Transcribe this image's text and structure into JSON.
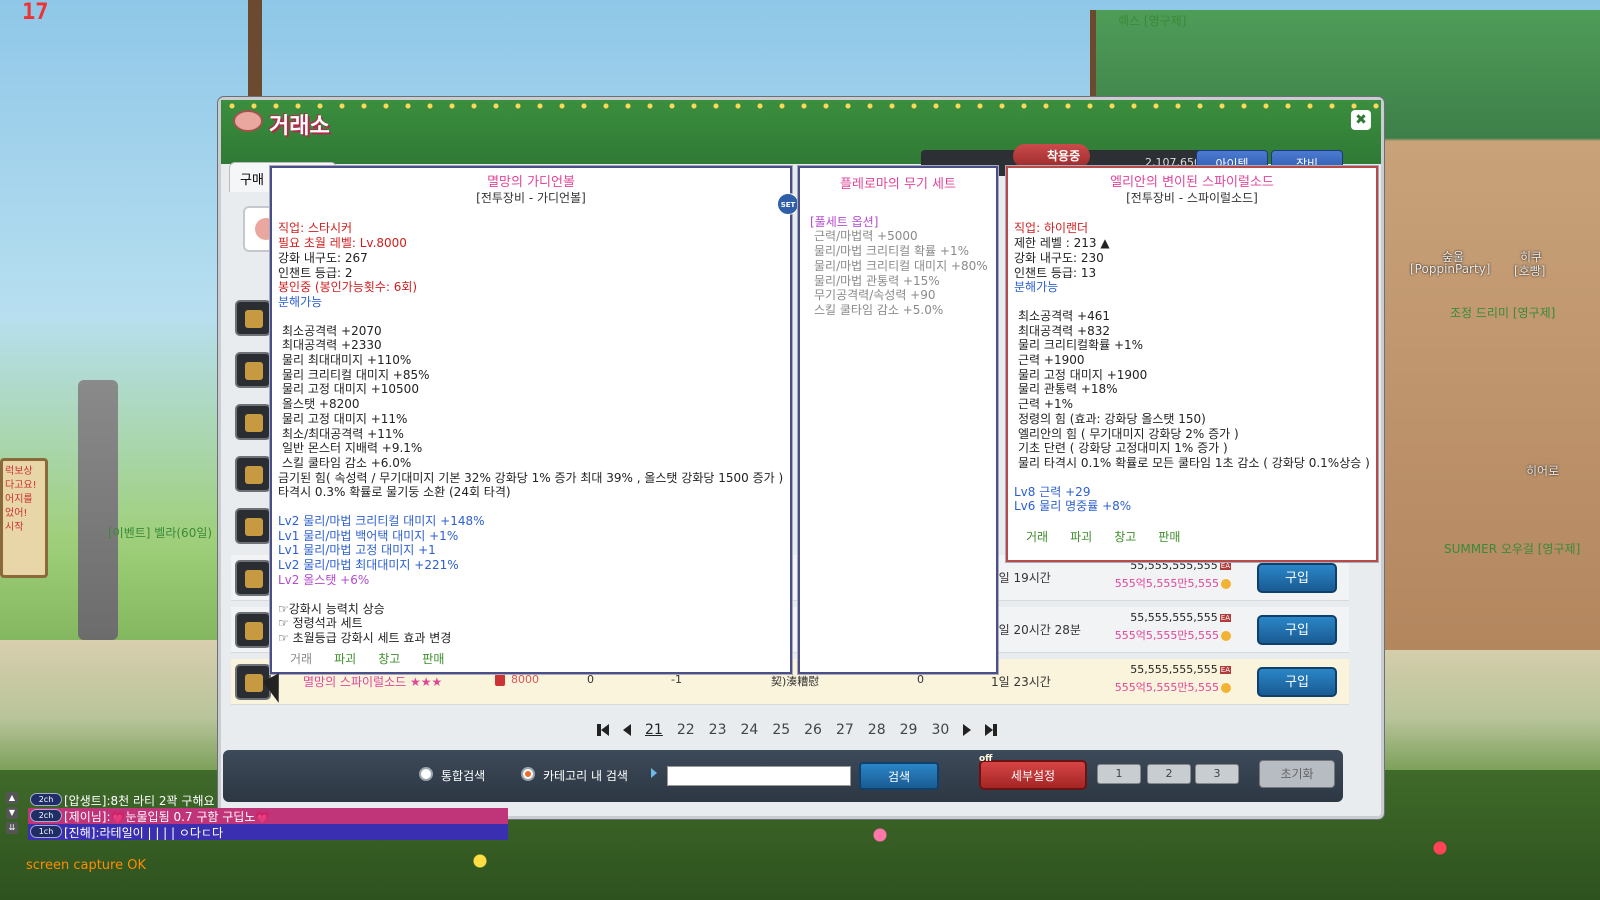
{
  "hud": {
    "top_left_number": "17"
  },
  "background": {
    "npc_names": [
      {
        "text": "렉스 [영구제]"
      },
      {
        "text": "[이벤트] 벨라(60일)"
      },
      {
        "text": "숲울"
      },
      {
        "text": "[PoppinParty]"
      },
      {
        "text": "히쿠"
      },
      {
        "text": "[호빵]"
      },
      {
        "text": "조정 드리미 [영구제]"
      },
      {
        "text": "히어로"
      },
      {
        "text": "SUMMER 오우걸 [영구제]"
      }
    ],
    "sign_text": "럭보상\n다고요!\n어지를\n었어!\n시작"
  },
  "window": {
    "title": "거래소",
    "close_label": "✖",
    "mesos": "2,107,650",
    "top_btn_item": "아이템",
    "top_btn_equip": "장비",
    "equipped_badge": "착용중",
    "tab_buy": "구매"
  },
  "listings": [
    {
      "time": "1일 19시간",
      "price": "55,555,555,555",
      "unit_price": "555억5,555만5,555",
      "buy": "구입"
    },
    {
      "time": "1일 20시간 28분",
      "price": "55,555,555,555",
      "unit_price": "555억5,555만5,555",
      "buy": "구입"
    },
    {
      "item_name": "멸망의 스파이럴소드",
      "stars": "★★★",
      "level": "8000",
      "col1": "0",
      "col2": "-1",
      "seller": "契)湊糟慰",
      "col3": "0",
      "time": "1일 23시간",
      "price": "55,555,555,555",
      "unit_price": "555억5,555만5,555",
      "buy": "구입"
    }
  ],
  "pagination": {
    "pages": [
      "21",
      "22",
      "23",
      "24",
      "25",
      "26",
      "27",
      "28",
      "29",
      "30"
    ],
    "active": "21"
  },
  "search": {
    "opt_all": "통합검색",
    "opt_category": "카테고리 내 검색",
    "input_value": "",
    "search_btn": "검색",
    "detail_btn": "세부설정",
    "off_tag": "off",
    "presets": [
      "1",
      "2",
      "3"
    ],
    "reset_btn": "초기화"
  },
  "tooltip_left": {
    "title": "멸망의 가디언볼",
    "subtitle": "[전투장비 - 가디언볼]",
    "job": "직업: 스타시커",
    "req_level": "필요 초월 레벨: Lv.8000",
    "durability": "강화 내구도: 267",
    "enchant": "인챈트 등급: 2",
    "sealed": "봉인중 (봉인가능횟수: 6회)",
    "dismantle": "분해가능",
    "stats": [
      "최소공격력 +2070",
      "최대공격력 +2330",
      "물리 최대대미지 +110%",
      "물리 크리티컬 대미지 +85%",
      "물리 고정 대미지 +10500",
      "올스탯 +8200",
      "물리 고정 대미지 +11%",
      "최소/최대공격력 +11%",
      "일반 몬스터 지배력 +9.1%",
      "스킬 쿨타임 감소 +6.0%"
    ],
    "special1": "금기된 힘( 속성력 / 무기대미지 기본 32% 강화당 1% 증가 최대 39% , 올스탯 강화당 1500 증가 )",
    "special2": "타격시 0.3% 확률로 물기둥 소환 (24회 타격)",
    "lv_opts": [
      "Lv2 물리/마법 크리티컬 대미지 +148%",
      "Lv1 물리/마법 백어택 대미지 +1%",
      "Lv1 물리/마법 고정 대미지 +1",
      "Lv2 물리/마법 최대대미지 +221%"
    ],
    "lv_opt_purple": "Lv2 올스탯 +6%",
    "notes": [
      "☞강화시 능력치 상승",
      "☞ 정령석과 세트",
      "☞ 초월등급 강화시 세트 효과 변경"
    ],
    "actions": [
      "거래",
      "파괴",
      "창고",
      "판매"
    ]
  },
  "tooltip_set": {
    "title": "플레로마의 무기 세트",
    "header": "[풀세트 옵션]",
    "lines": [
      "근력/마법력 +5000",
      "물리/마법 크리티컬 확률 +1%",
      "물리/마법 크리티컬 대미지 +80%",
      "물리/마법 관통력 +15%",
      "무기공격력/속성력 +90",
      "스킬 쿨타임 감소 +5.0%"
    ],
    "badge": "SET"
  },
  "tooltip_right": {
    "title": "엘리안의 변이된 스파이럴소드",
    "subtitle": "[전투장비 - 스파이럴소드]",
    "job": "직업: 하이랜더",
    "req_level": "제한 레벨 : 213 ▲",
    "durability": "강화 내구도: 230",
    "enchant": "인챈트 등급: 13",
    "dismantle": "분해가능",
    "stats": [
      "최소공격력 +461",
      "최대공격력 +832",
      "물리 크리티컬확률 +1%",
      "근력 +1900",
      "물리 고정 대미지 +1900",
      "물리 관통력 +18%",
      "근력 +1%",
      "정령의 힘 (효과: 강화당 올스탯 150)",
      "엘리안의 힘 ( 무기대미지 강화당 2% 증가 )",
      "기초 단련 ( 강화당 고정대미지 1% 증가 )",
      "물리 타격시 0.1% 확률로 모든 쿨타임 1초 감소 ( 강화당 0.1%상승 )"
    ],
    "lv_opts": [
      "Lv8 근력 +29",
      "Lv6 물리 명중률 +8%"
    ],
    "actions": [
      "거래",
      "파괴",
      "창고",
      "판매"
    ]
  },
  "chat": {
    "lines": [
      {
        "ch": "2ch",
        "text": "[압생트]:8천 라티 2꽉 구해요"
      },
      {
        "ch": "2ch",
        "text": "[제이님]:💗눈물입됨 0.7 구함 구딥노💗"
      },
      {
        "ch": "1ch",
        "text": "[진해]:라테일이 | | | | ㅇ다ㄷ다"
      }
    ],
    "status": "screen capture OK",
    "line_colors": [
      "transparent",
      "#c0357a",
      "#3a2fb0"
    ]
  }
}
